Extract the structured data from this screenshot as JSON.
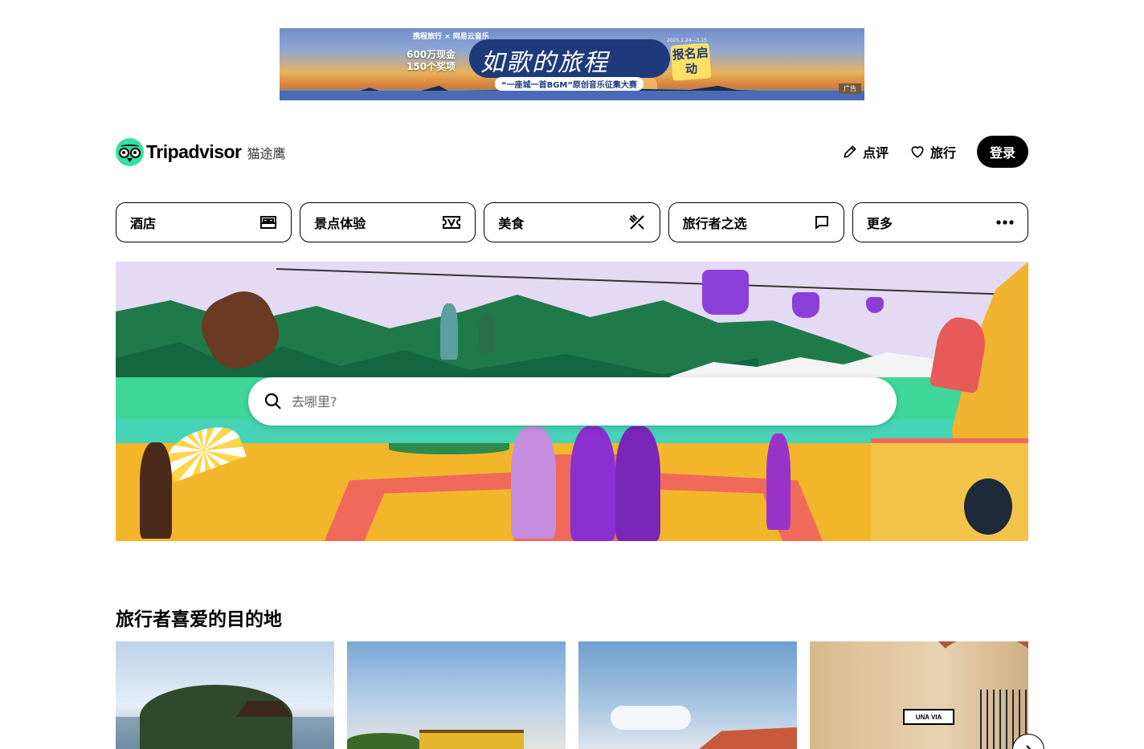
{
  "ad": {
    "brands": "携程旅行 × 网易云音乐",
    "prize_line1": "600万现金",
    "prize_line2": "150个奖项",
    "title": "如歌的旅程",
    "date": "2025.1.24—3.15",
    "signup": "报名启动",
    "subtitle": "“一座城一首BGM”原创音乐征集大赛",
    "tag": "广告"
  },
  "header": {
    "logo_text": "Tripadvisor",
    "logo_cn": "猫途鹰",
    "review_label": "点评",
    "trips_label": "旅行",
    "login_label": "登录"
  },
  "categories": [
    {
      "label": "酒店",
      "icon": "bed-icon"
    },
    {
      "label": "景点体验",
      "icon": "ticket-icon"
    },
    {
      "label": "美食",
      "icon": "utensils-icon"
    },
    {
      "label": "旅行者之选",
      "icon": "chat-bubble-icon"
    },
    {
      "label": "更多",
      "icon": "more-dots-icon"
    }
  ],
  "search": {
    "placeholder": "去哪里?"
  },
  "destinations": {
    "title": "旅行者喜爱的目的地",
    "card4_sign": "UNA VIA"
  },
  "colors": {
    "brand_green": "#34e0a1",
    "text": "#000000",
    "login_bg": "#000000"
  }
}
